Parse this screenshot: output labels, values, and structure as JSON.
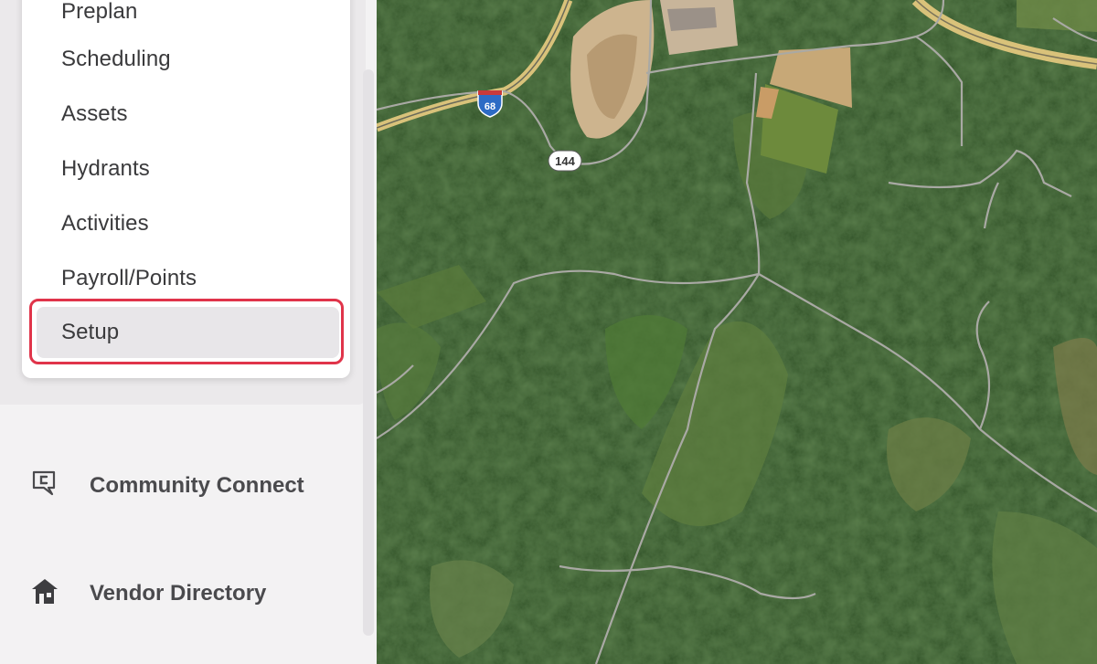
{
  "sidebar": {
    "menu": {
      "items": [
        {
          "label": "Preplan"
        },
        {
          "label": "Scheduling"
        },
        {
          "label": "Assets"
        },
        {
          "label": "Hydrants"
        },
        {
          "label": "Activities"
        },
        {
          "label": "Payroll/Points"
        },
        {
          "label": "Setup",
          "active": true
        }
      ]
    },
    "nav": [
      {
        "label": "Community Connect",
        "icon": "community-connect-icon"
      },
      {
        "label": "Vendor Directory",
        "icon": "house-icon"
      }
    ]
  },
  "map": {
    "type": "satellite",
    "shields": {
      "interstate": "68",
      "state_route": "144"
    }
  },
  "colors": {
    "highlight": "#e0344a",
    "sidebar_bg": "#f3f2f3",
    "menu_bg": "#ffffff",
    "active_item_bg": "#e8e6e9"
  }
}
